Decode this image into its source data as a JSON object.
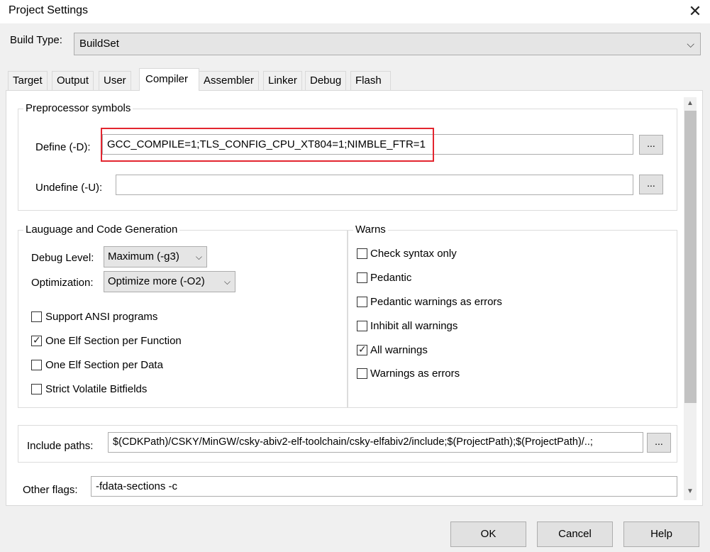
{
  "window": {
    "title": "Project Settings"
  },
  "build": {
    "label": "Build Type:",
    "value": "BuildSet"
  },
  "tabs": [
    "Target",
    "Output",
    "User",
    "Compiler",
    "Assembler",
    "Linker",
    "Debug",
    "Flash"
  ],
  "preprocessor": {
    "title": "Preprocessor symbols",
    "define_label": "Define (-D):",
    "define_value": "GCC_COMPILE=1;TLS_CONFIG_CPU_XT804=1;NIMBLE_FTR=1",
    "undefine_label": "Undefine (-U):",
    "undefine_value": "",
    "browse": "..."
  },
  "language": {
    "title": "Lauguage and Code Generation",
    "debug_label": "Debug Level:",
    "debug_value": "Maximum (-g3)",
    "opt_label": "Optimization:",
    "opt_value": "Optimize more (-O2)",
    "checks": [
      {
        "label": "Support ANSI programs",
        "checked": false
      },
      {
        "label": "One Elf Section per Function",
        "checked": true
      },
      {
        "label": "One Elf Section per Data",
        "checked": false
      },
      {
        "label": "Strict Volatile Bitfields",
        "checked": false
      }
    ]
  },
  "warns": {
    "title": "Warns",
    "checks": [
      {
        "label": "Check syntax only",
        "checked": false
      },
      {
        "label": "Pedantic",
        "checked": false
      },
      {
        "label": "Pedantic warnings as errors",
        "checked": false
      },
      {
        "label": "Inhibit all warnings",
        "checked": false
      },
      {
        "label": "All warnings",
        "checked": true
      },
      {
        "label": "Warnings as errors",
        "checked": false
      }
    ]
  },
  "include": {
    "label": "Include paths:",
    "value": "$(CDKPath)/CSKY/MinGW/csky-abiv2-elf-toolchain/csky-elfabiv2/include;$(ProjectPath);$(ProjectPath)/..;",
    "browse": "..."
  },
  "other": {
    "label": "Other flags:",
    "value": "-fdata-sections -c"
  },
  "buttons": {
    "ok": "OK",
    "cancel": "Cancel",
    "help": "Help"
  },
  "colors": {
    "highlight": "#e3252f",
    "dialog_bg": "#f0f0f0"
  }
}
